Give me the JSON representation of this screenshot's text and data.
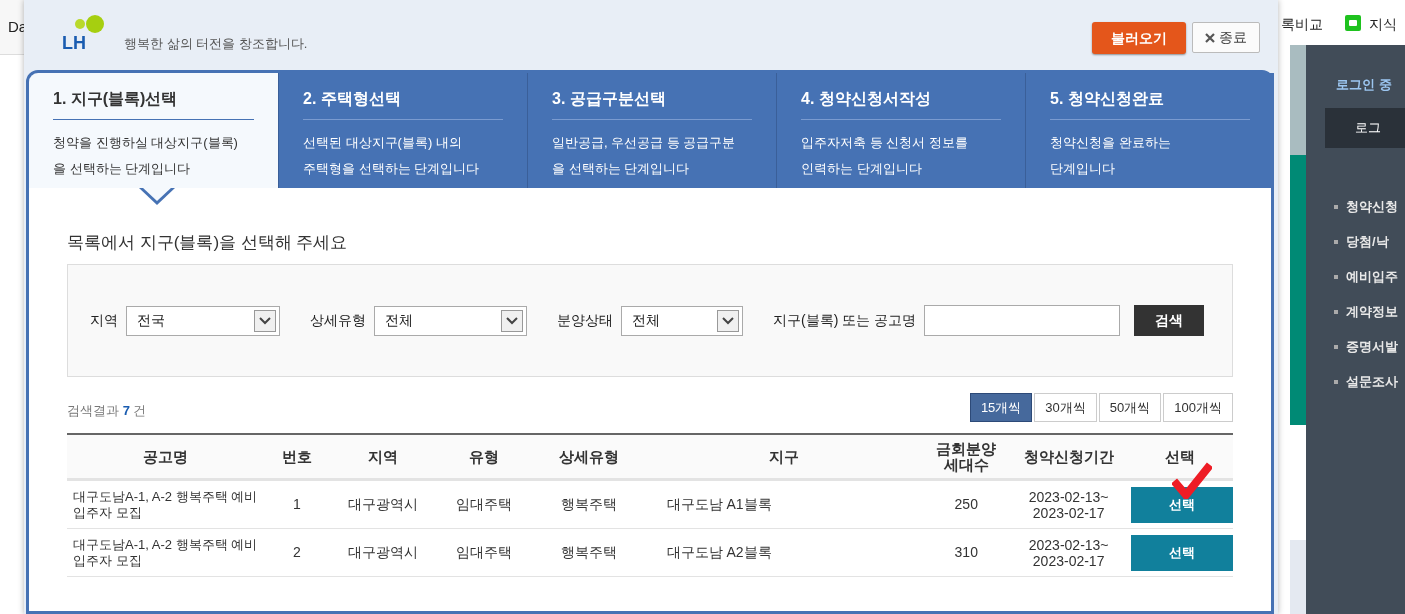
{
  "background_page": {
    "left_text": "Da",
    "top_links": [
      {
        "label": "록비교",
        "kind": "text"
      },
      {
        "label": "지식",
        "kind": "app"
      }
    ],
    "sidebar_notice": "로그인 중",
    "sidebar_button": "로그",
    "sidebar_menu": [
      "청약신청",
      "당첨/낙",
      "예비입주",
      "계약정보",
      "증명서발",
      "설문조사"
    ]
  },
  "header": {
    "logo_text": "LH",
    "slogan": "행복한 삶의 터전을 창조합니다.",
    "load_button": "불러오기",
    "close_button": "종료"
  },
  "steps": [
    {
      "title": "1. 지구(블록)선택",
      "description_lines": [
        "청약을 진행하실 대상지구(블록)",
        "을 선택하는 단계입니다"
      ],
      "selected": true
    },
    {
      "title": "2. 주택형선택",
      "description_lines": [
        "선택된 대상지구(블록) 내의",
        "주택형을 선택하는 단계입니다"
      ],
      "selected": false
    },
    {
      "title": "3. 공급구분선택",
      "description_lines": [
        "일반공급, 우선공급 등 공급구분",
        "을 선택하는 단계입니다"
      ],
      "selected": false
    },
    {
      "title": "4. 청약신청서작성",
      "description_lines": [
        "입주자저축 등 신청서 정보를",
        "인력하는 단계입니다"
      ],
      "selected": false
    },
    {
      "title": "5. 청약신청완료",
      "description_lines": [
        "청약신청을 완료하는",
        "단계입니다"
      ],
      "selected": false
    }
  ],
  "section_title": "목록에서 지구(블록)을 선택해 주세요",
  "filters": [
    {
      "kind": "select",
      "label": "지역",
      "value": "전국"
    },
    {
      "kind": "select",
      "label": "상세유형",
      "value": "전체"
    },
    {
      "kind": "select",
      "label": "분양상태",
      "value": "전체"
    },
    {
      "kind": "text",
      "label": "지구(블록) 또는 공고명"
    }
  ],
  "search_button": "검색",
  "result": {
    "prefix": "검색결과",
    "count": "7",
    "suffix": "건"
  },
  "page_sizes": [
    {
      "label": "15개씩",
      "selected": true
    },
    {
      "label": "30개씩",
      "selected": false
    },
    {
      "label": "50개씩",
      "selected": false
    },
    {
      "label": "100개씩",
      "selected": false
    }
  ],
  "table": {
    "columns": [
      "공고명",
      "번호",
      "지역",
      "유형",
      "상세유형",
      "지구",
      "금회분양 세대수",
      "청약신청기간",
      "선택"
    ],
    "rows": [
      {
        "notice": "대구도남A-1, A-2 행복주택 예비입주자 모집",
        "number": "1",
        "region": "대구광역시",
        "type": "임대주택",
        "detail_type": "행복주택",
        "district": "대구도남 A1블록",
        "units": "250",
        "period_start": "2023-02-13~",
        "period_end": "2023-02-17",
        "select_button": "선택",
        "marked": true
      },
      {
        "notice": "대구도남A-1, A-2 행복주택 예비입주자 모집",
        "number": "2",
        "region": "대구광역시",
        "type": "임대주택",
        "detail_type": "행복주택",
        "district": "대구도남 A2블록",
        "units": "310",
        "period_start": "2023-02-13~",
        "period_end": "2023-02-17",
        "select_button": "선택",
        "marked": false
      }
    ]
  }
}
